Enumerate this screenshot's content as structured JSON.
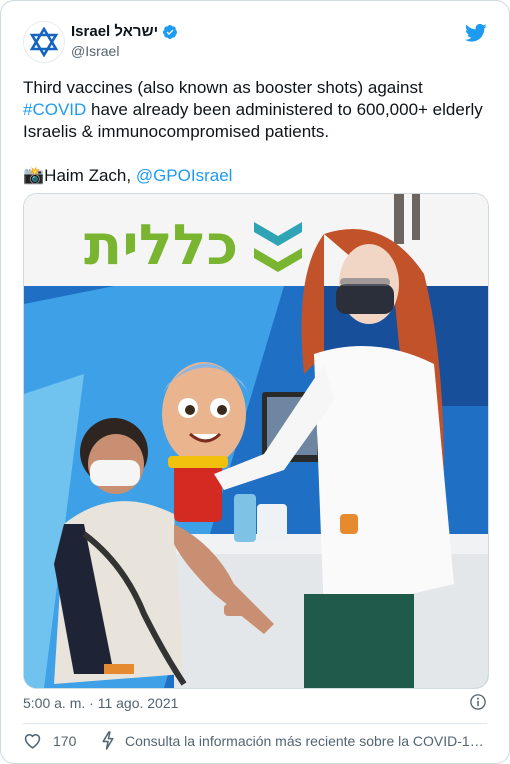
{
  "tweet": {
    "author": {
      "display_name": "Israel ישראל",
      "handle": "@Israel",
      "avatar_icon": "star-of-david-icon",
      "verified_icon": "verified-badge-icon"
    },
    "brand_icon": "twitter-bird-icon",
    "text_line1_pre": "Third vaccines (also known as booster shots) against",
    "hashtag": "#COVID",
    "text_line1_post": " have already been administered to 600,000+ elderly Israelis & immunocompromised patients.",
    "camera_emoji": "📸",
    "credit_text": "Haim Zach, ",
    "mention": "@GPOIsrael",
    "photo": {
      "sign_text": "כללית"
    },
    "timestamp": "5:00 a. m. · 11 ago. 2021",
    "like_count": "170",
    "covid_info": "Consulta la información más reciente sobre la COVID-19…"
  },
  "colors": {
    "accent": "#1d9bf0",
    "text": "#0f1419",
    "muted": "#536471",
    "clalit_green": "#7ab531",
    "clalit_teal": "#2fa4b4"
  }
}
